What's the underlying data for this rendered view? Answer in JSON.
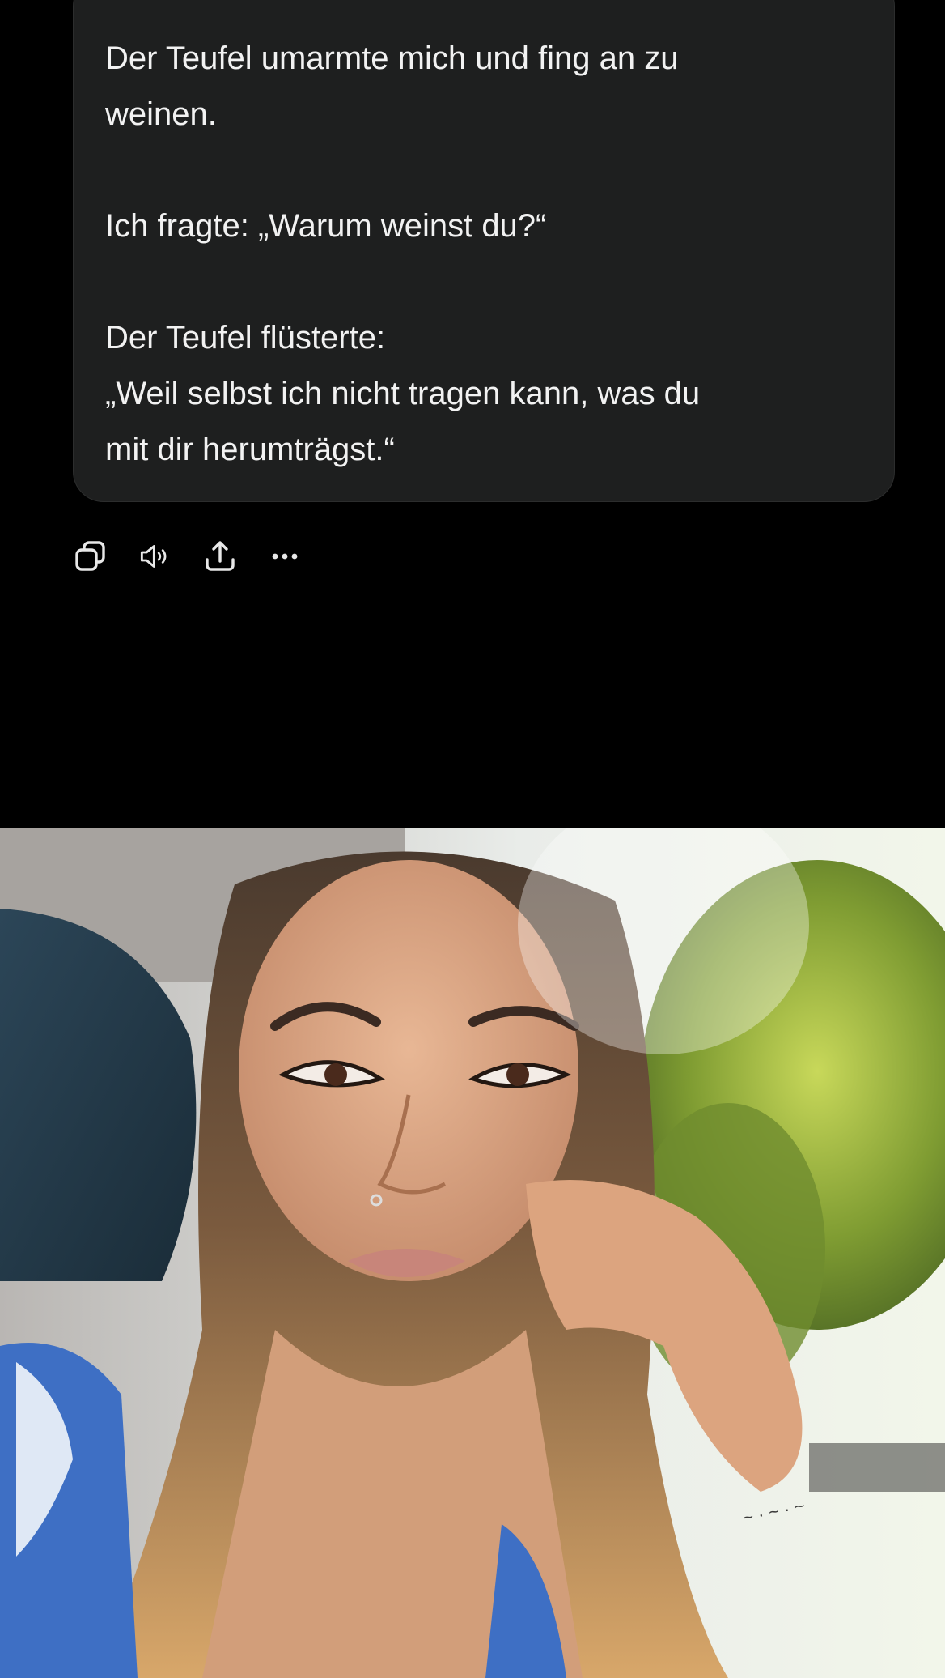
{
  "message": {
    "lines": [
      "Der Teufel umarmte mich und fing an zu",
      "weinen.",
      "",
      "Ich fragte: „Warum weinst du?“",
      "",
      "Der Teufel flüsterte:",
      "„Weil selbst ich nicht tragen kann, was du",
      "mit dir herumträgst.“"
    ]
  },
  "actions": {
    "icons": [
      "copy-icon",
      "speaker-icon",
      "share-icon",
      "more-icon"
    ]
  },
  "photo": {
    "subject": "selfie-photo"
  },
  "colors": {
    "background": "#000000",
    "bubble": "#1e1f1f",
    "text": "#f2f2f2",
    "icon": "#e8e8e8"
  }
}
